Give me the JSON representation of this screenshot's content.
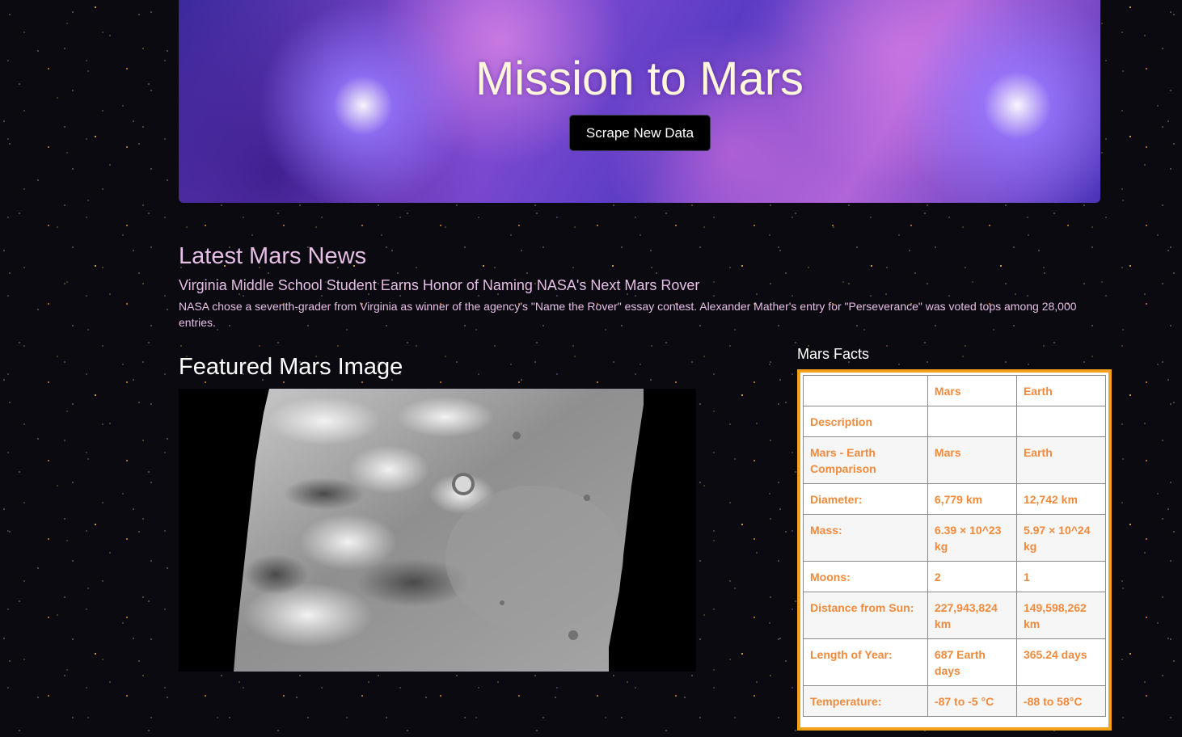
{
  "hero": {
    "title": "Mission to Mars",
    "button_label": "Scrape New Data"
  },
  "news": {
    "heading": "Latest Mars News",
    "title": "Virginia Middle School Student Earns Honor of Naming NASA's Next Mars Rover",
    "paragraph": "NASA chose a seventh-grader from Virginia as winner of the agency's \"Name the Rover\" essay contest. Alexander Mather's entry for \"Perseverance\" was voted tops among 28,000 entries."
  },
  "featured": {
    "heading": "Featured Mars Image",
    "image_alt": "Mars surface"
  },
  "facts": {
    "heading": "Mars Facts",
    "columns": [
      "",
      "Mars",
      "Earth"
    ],
    "rows": [
      [
        "Description",
        "",
        ""
      ],
      [
        "Mars - Earth Comparison",
        "Mars",
        "Earth"
      ],
      [
        "Diameter:",
        "6,779 km",
        "12,742 km"
      ],
      [
        "Mass:",
        "6.39 × 10^23 kg",
        "5.97 × 10^24 kg"
      ],
      [
        "Moons:",
        "2",
        "1"
      ],
      [
        "Distance from Sun:",
        "227,943,824 km",
        "149,598,262 km"
      ],
      [
        "Length of Year:",
        "687 Earth days",
        "365.24 days"
      ],
      [
        "Temperature:",
        "-87 to -5 °C",
        "-88 to 58°C"
      ]
    ]
  },
  "colors": {
    "facts_text": "#f08a3c",
    "facts_border": "#f5a019",
    "news_text": "#e6bfe6"
  }
}
